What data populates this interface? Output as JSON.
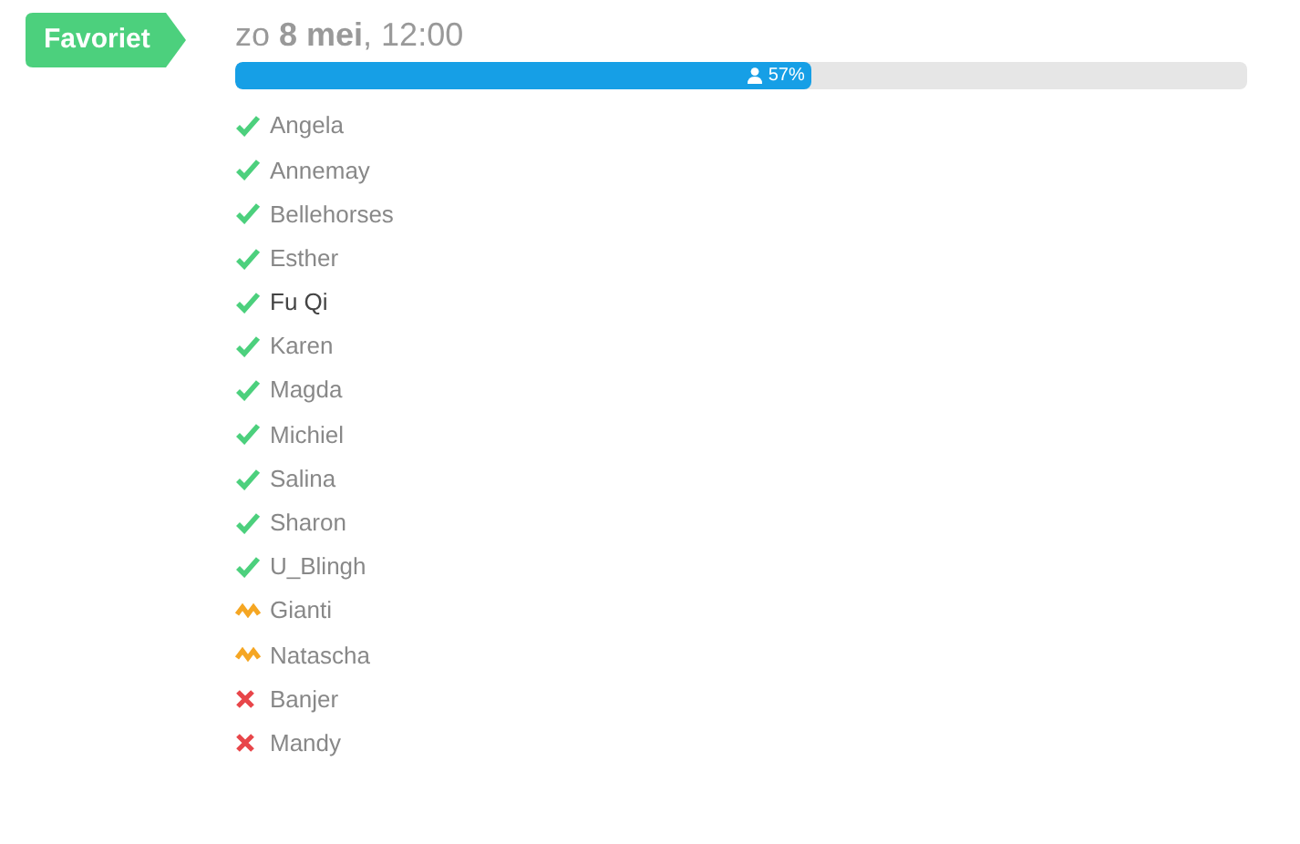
{
  "badge": "Favoriet",
  "date": "zo **8 mei**, 12:00",
  "progress": {
    "level": 0.57,
    "reading": "57%"
  },
  "people": [
    {
      "name": "Angela",
      "kind": "yes",
      "emphasized": false
    },
    {
      "name": "Annemay",
      "kind": "yes",
      "emphasized": false
    },
    {
      "name": "Bellehorses",
      "kind": "yes",
      "emphasized": false
    },
    {
      "name": "Esther",
      "kind": "yes",
      "emphasized": false
    },
    {
      "name": "Fu Qi",
      "kind": "yes",
      "emphasized": true
    },
    {
      "name": "Karen",
      "kind": "yes",
      "emphasized": false
    },
    {
      "name": "Magda",
      "kind": "yes",
      "emphasized": false
    },
    {
      "name": "Michiel",
      "kind": "yes",
      "emphasized": false
    },
    {
      "name": "Salina",
      "kind": "yes",
      "emphasized": false
    },
    {
      "name": "Sharon",
      "kind": "yes",
      "emphasized": false
    },
    {
      "name": "U_Blingh",
      "kind": "yes",
      "emphasized": false
    },
    {
      "name": "Gianti",
      "kind": "maybe",
      "emphasized": false
    },
    {
      "name": "Natascha",
      "kind": "maybe",
      "emphasized": false
    },
    {
      "name": "Banjer",
      "kind": "no",
      "emphasized": false
    },
    {
      "name": "Mandy",
      "kind": "no",
      "emphasized": false
    }
  ]
}
